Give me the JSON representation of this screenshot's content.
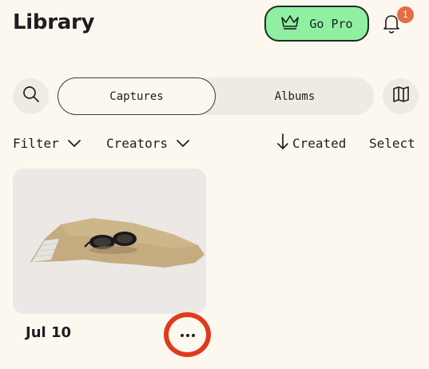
{
  "header": {
    "title": "Library",
    "go_pro_label": "Go Pro",
    "go_pro_icon": "crown-icon",
    "notification_count": "1",
    "notification_icon": "bell-icon"
  },
  "tabs": {
    "search_icon": "search-icon",
    "items": [
      {
        "label": "Captures",
        "active": true
      },
      {
        "label": "Albums",
        "active": false
      }
    ],
    "map_icon": "map-icon"
  },
  "filters": {
    "filter_label": "Filter",
    "creators_label": "Creators",
    "sort_label": "Created",
    "sort_icon": "arrow-down-icon",
    "select_label": "Select"
  },
  "captures": [
    {
      "date": "Jul 10",
      "more_icon": "more-horizontal-icon"
    }
  ],
  "colors": {
    "background": "#fcf8ef",
    "go_pro": "#8ef0a0",
    "badge": "#e46d43",
    "highlight_ring": "#e03a1c"
  }
}
